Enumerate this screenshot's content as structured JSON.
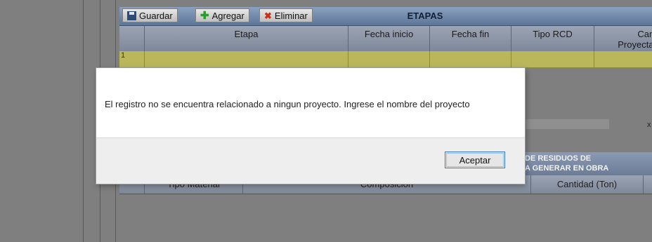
{
  "etapas": {
    "toolbar": {
      "save_label": "Guardar",
      "add_label": "Agregar",
      "delete_label": "Eliminar",
      "title": "ETAPAS"
    },
    "columns": [
      "Etapa",
      "Fecha inicio",
      "Fecha fin",
      "Tipo RCD",
      "Cantid",
      "Proyectada"
    ],
    "rows": [
      {
        "num": "1"
      }
    ]
  },
  "residuos": {
    "title_line1": "DE RESIDUOS DE",
    "title_line2": "A GENERAR EN OBRA",
    "columns": [
      "Tipo Material",
      "Composicion",
      "Cantidad (Ton)"
    ]
  },
  "modal": {
    "message": "El registro no se encuentra relacionado a ningun proyecto. Ingrese el nombre del proyecto",
    "ok_label": "Aceptar"
  },
  "misc": {
    "close_x": "x"
  }
}
